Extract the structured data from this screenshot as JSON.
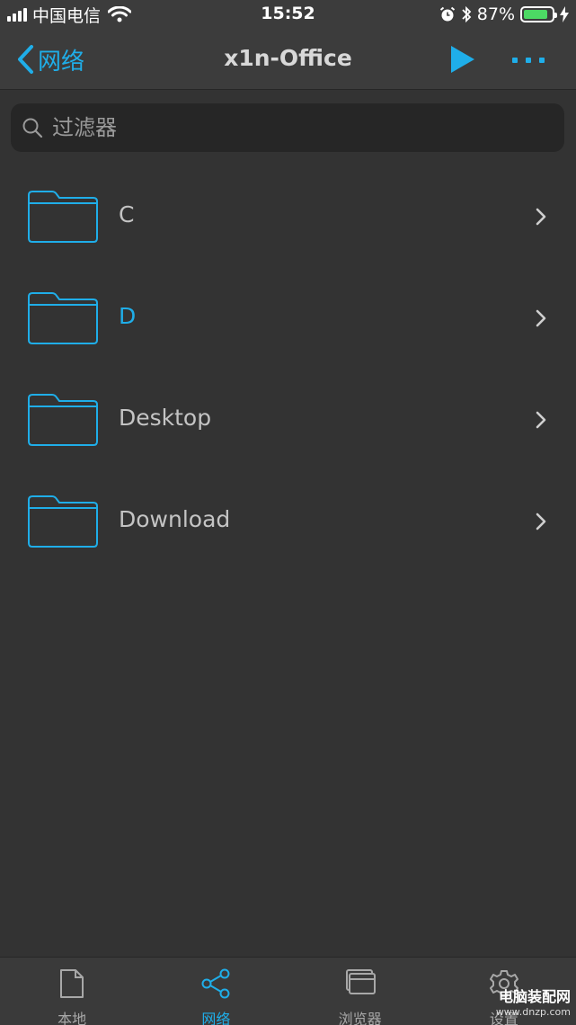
{
  "status_bar": {
    "carrier": "中国电信",
    "time": "15:52",
    "battery_percent": "87%",
    "battery_level": 0.87,
    "icons": [
      "signal-icon",
      "wifi-icon",
      "alarm-icon",
      "bluetooth-icon",
      "battery-icon",
      "charging-icon"
    ]
  },
  "nav": {
    "back_label": "网络",
    "title": "x1n-Office",
    "icons": [
      "chevron-left-icon",
      "play-icon",
      "more-icon"
    ]
  },
  "search": {
    "placeholder": "过滤器",
    "value": ""
  },
  "files": [
    {
      "name": "C",
      "icon": "folder-icon",
      "selected": false
    },
    {
      "name": "D",
      "icon": "folder-icon",
      "selected": true
    },
    {
      "name": "Desktop",
      "icon": "folder-icon",
      "selected": false
    },
    {
      "name": "Download",
      "icon": "folder-icon",
      "selected": false
    }
  ],
  "tabs": [
    {
      "label": "本地",
      "icon": "document-icon",
      "active": false
    },
    {
      "label": "网络",
      "icon": "share-icon",
      "active": true
    },
    {
      "label": "浏览器",
      "icon": "browser-icon",
      "active": false
    },
    {
      "label": "设置",
      "icon": "gear-icon",
      "active": false
    }
  ],
  "watermark": {
    "line1": "电脑装配网",
    "line2": "www.dnzp.com"
  },
  "colors": {
    "accent": "#1faee9",
    "background": "#333333",
    "bar_background": "#3c3c3c",
    "battery": "#4cd964"
  }
}
